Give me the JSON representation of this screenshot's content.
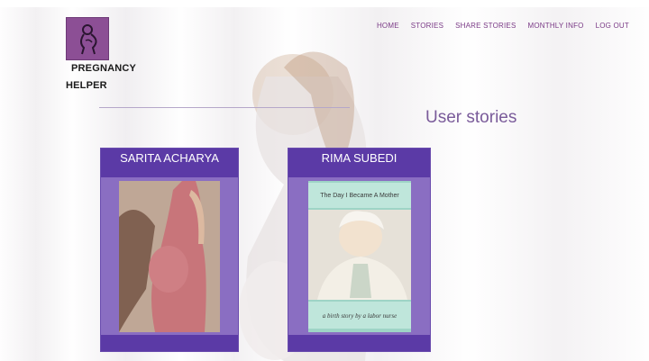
{
  "brand": {
    "line1": "PREGNANCY",
    "line2": "HELPER"
  },
  "nav": {
    "items": [
      "HOME",
      "STORIES",
      "SHARE STORIES",
      "MONTHLY INFO",
      "LOG OUT"
    ]
  },
  "page": {
    "title": "User stories"
  },
  "stories": [
    {
      "author": "SARITA ACHARYA"
    },
    {
      "author": "RIMA SUBEDI",
      "cover_title": "The Day I Became A Mother",
      "cover_subtitle": "a birth story by a labor nurse"
    }
  ],
  "colors": {
    "accent": "#5b3aa6",
    "card_bg": "#8a6ec2",
    "nav_text": "#7a3a86",
    "logo_bg": "#8c4f95"
  }
}
